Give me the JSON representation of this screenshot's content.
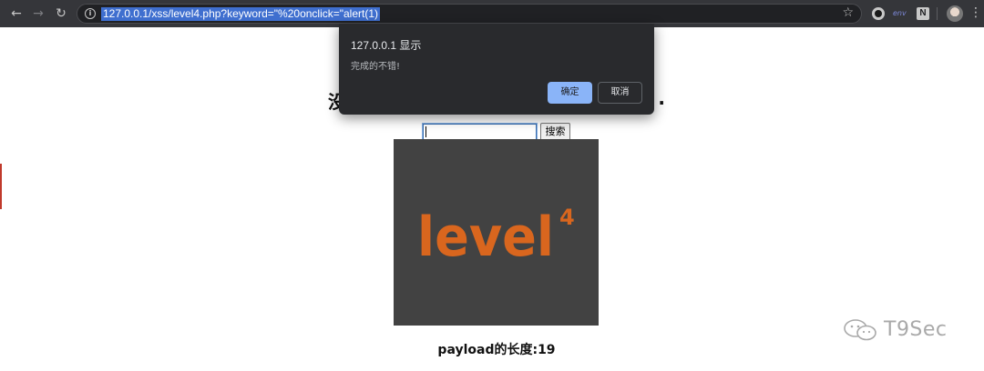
{
  "browser": {
    "url": "127.0.0.1/xss/level4.php?keyword=\"%20onclick=\"alert(1)",
    "icons": {
      "back": "arrow-left-icon",
      "forward": "arrow-right-icon",
      "reload": "reload-icon",
      "info": "info-icon",
      "bookmark": "star-icon",
      "menu": "kebab-menu-icon"
    },
    "extensions": [
      {
        "name": "circle-extension-icon"
      },
      {
        "name": "script-extension-icon",
        "label": "env"
      },
      {
        "name": "notion-extension-icon",
        "label": "N"
      }
    ]
  },
  "alert": {
    "title": "127.0.0.1 显示",
    "message": "完成的不错!",
    "ok_label": "确定",
    "cancel_label": "取消",
    "ok_color": "#8ab4f8"
  },
  "page": {
    "heading_left": "没",
    "heading_right": ".",
    "search_button": "搜索",
    "search_value": "",
    "image": {
      "name": "level4-logo",
      "text": "level",
      "number": "4",
      "bg_color": "#424242",
      "text_color": "#d9661e"
    },
    "payload_length": "payload的长度:19"
  },
  "watermark": {
    "text": "T9Sec"
  }
}
